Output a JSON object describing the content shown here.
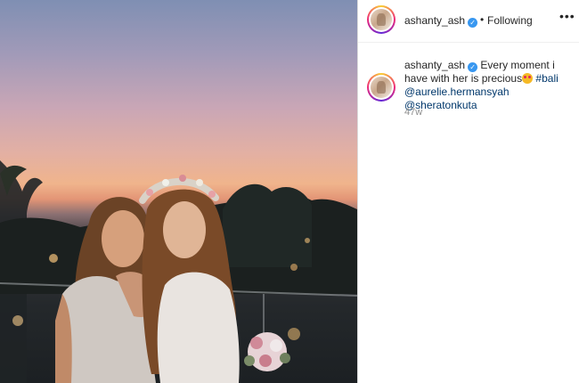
{
  "post": {
    "username": "ashanty_ash",
    "verified_icon": "verified-badge-icon",
    "separator": "•",
    "follow_status": "Following",
    "more_label": "•••",
    "caption": {
      "username": "ashanty_ash",
      "text_before": "Every moment i have with her is precious",
      "emoji": "heart-eyes-emoji",
      "hashtag": "#bali",
      "mention1": "@aurelie.hermansyah",
      "mention2": "@sheratonkuta"
    },
    "time_ago": "47w"
  },
  "colors": {
    "verified": "#3897f0",
    "link": "#00376b",
    "muted": "#8e8e8e",
    "divider": "#dbdbdb"
  }
}
